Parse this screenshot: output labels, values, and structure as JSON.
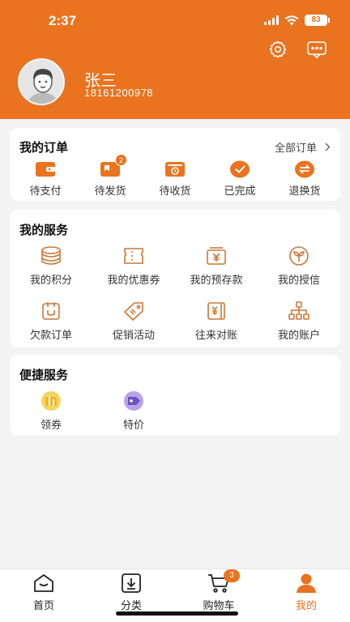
{
  "status_bar": {
    "time": "2:37",
    "battery": "83"
  },
  "colors": {
    "accent": "#e9731f",
    "background": "#f4f4f4"
  },
  "user": {
    "name": "张三",
    "phone": "18161200978"
  },
  "header_icons": [
    "settings-icon",
    "message-icon"
  ],
  "orders": {
    "title": "我的订单",
    "all_label": "全部订单",
    "items": [
      {
        "label": "待支付",
        "icon": "wallet-icon"
      },
      {
        "label": "待发货",
        "icon": "shipment-icon",
        "badge": "2"
      },
      {
        "label": "待收货",
        "icon": "receive-icon"
      },
      {
        "label": "已完成",
        "icon": "check-icon"
      },
      {
        "label": "退换货",
        "icon": "exchange-icon"
      }
    ]
  },
  "services": {
    "title": "我的服务",
    "items": [
      {
        "label": "我的积分",
        "icon": "coins-icon"
      },
      {
        "label": "我的优惠券",
        "icon": "ticket-icon"
      },
      {
        "label": "我的预存款",
        "icon": "deposit-icon"
      },
      {
        "label": "我的授信",
        "icon": "credit-icon"
      },
      {
        "label": "欠款订单",
        "icon": "debt-order-icon"
      },
      {
        "label": "促销活动",
        "icon": "promotion-tag-icon"
      },
      {
        "label": "往来对账",
        "icon": "reconcile-icon"
      },
      {
        "label": "我的账户",
        "icon": "account-tree-icon"
      }
    ]
  },
  "quick": {
    "title": "便捷服务",
    "items": [
      {
        "label": "领券",
        "icon": "coupon-icon"
      },
      {
        "label": "特价",
        "icon": "special-price-icon"
      }
    ]
  },
  "tabbar": {
    "items": [
      {
        "label": "首页",
        "icon": "home-icon"
      },
      {
        "label": "分类",
        "icon": "category-icon"
      },
      {
        "label": "购物车",
        "icon": "cart-icon",
        "badge": "3"
      },
      {
        "label": "我的",
        "icon": "profile-icon",
        "active": true
      }
    ]
  }
}
